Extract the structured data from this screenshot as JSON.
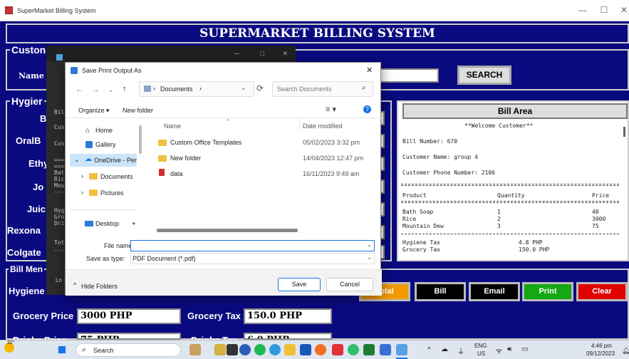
{
  "window": {
    "title": "SuperMarket Billing System",
    "min": "—",
    "max": "☐",
    "close": "✕"
  },
  "app": {
    "banner": "SUPERMARKET BILLING SYSTEM",
    "customer": {
      "frame_label": "Custon",
      "name_label": "Name",
      "name_value": "",
      "search_label": "SEARCH"
    },
    "hygiene": {
      "frame_label": "Hygier",
      "labels": [
        "B",
        "OralB",
        "Ethy",
        "Jo",
        "Juic",
        "Rexona",
        "Colgate"
      ]
    },
    "bill_menu": {
      "frame_label": "Bill Men",
      "rows": [
        {
          "price_label": "Hygiene Price",
          "price_value": "",
          "tax_label": "",
          "tax_value": ""
        },
        {
          "price_label": "Grocery Price",
          "price_value": "3000 PHP",
          "tax_label": "Grocery Tax",
          "tax_value": "150.0 PHP"
        },
        {
          "price_label": "Drinks Price",
          "price_value": "75 PHP",
          "tax_label": "Drinks Tax",
          "tax_value": "6.0 PHP"
        }
      ],
      "buttons": {
        "total": "Total",
        "bill": "Bill",
        "email": "Email",
        "print": "Print",
        "clear": "Clear"
      }
    },
    "bill_area": {
      "header": "Bill Area",
      "welcome": "**Welcome Customer**",
      "bill_number": "Bill Number: 670",
      "customer_name": "Customer Name: group 4",
      "phone": "Customer Phone Number: 2106",
      "col_product": "Product",
      "col_quantity": "Quantity",
      "col_price": "Price",
      "items": [
        {
          "product": "Bath Soap",
          "qty": "1",
          "price": "40"
        },
        {
          "product": "Rice",
          "qty": "2",
          "price": "3000"
        },
        {
          "product": "Mountain Dew",
          "qty": "3",
          "price": "75"
        }
      ],
      "taxes": [
        {
          "label": "Hygiene Tax",
          "value": "4.8 PHP"
        },
        {
          "label": "Grocery Tax",
          "value": "150.0 PHP"
        }
      ]
    }
  },
  "console": {
    "lines": [
      "Bil",
      "Cus",
      "Cust",
      "====",
      "====",
      "Bath",
      "Rice",
      "Moun",
      "----",
      "Hyg:",
      "Groc",
      "Dri",
      "Tota",
      "----"
    ],
    "footer": "Ln 1,"
  },
  "dialog": {
    "title": "Save Print Output As",
    "path_root": "Documents",
    "search_placeholder": "Search Documents",
    "organize": "Organize ▾",
    "new_folder": "New folder",
    "nav": [
      {
        "label": "Home"
      },
      {
        "label": "Gallery"
      },
      {
        "label": "OneDrive - Perso"
      },
      {
        "label": "Documents"
      },
      {
        "label": "Pictures"
      },
      {
        "label": "Desktop"
      }
    ],
    "col_name": "Name",
    "col_date": "Date modified",
    "files": [
      {
        "name": "Custom Office Templates",
        "date": "05/02/2023 3:32 pm"
      },
      {
        "name": "New folder",
        "date": "14/04/2023 12:47 pm"
      },
      {
        "name": "data",
        "date": "16/11/2023 9:49 am"
      }
    ],
    "file_name_label": "File name:",
    "file_name_value": "",
    "save_type_label": "Save as type:",
    "save_type_value": "PDF Document (*.pdf)",
    "hide_folders": "Hide Folders",
    "save": "Save",
    "cancel": "Cancel"
  },
  "taskbar": {
    "weather": "32°",
    "search": "Search",
    "lang_top": "ENG",
    "lang_bottom": "US",
    "time": "4:46 pm",
    "date": "09/12/2023"
  }
}
